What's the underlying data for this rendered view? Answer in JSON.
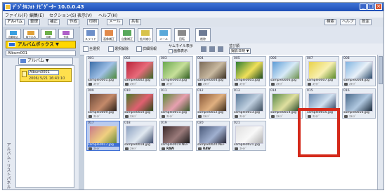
{
  "window": {
    "title": "ﾃﾞｼﾞﾀﾙﾌｫﾄ ﾅﾋﾞｹﾞｰﾀｰ 10.0.0.43",
    "controls": [
      "_",
      "□",
      "×"
    ]
  },
  "menubar": [
    "ファイル(F)",
    "編集(E)",
    "セクション(S)",
    "表示(V)",
    "ヘルプ(H)"
  ],
  "top_tabs": [
    "アルバム",
    "整理",
    "補正",
    "作成",
    "印刷",
    "メール",
    "共有"
  ],
  "right_tabs": [
    "検索",
    "ヘルプ",
    "設定"
  ],
  "left_panel": {
    "big_icons": [
      "自動取込",
      "取り込み",
      "印刷",
      "作成"
    ],
    "album_box_label": "アルバムボックス",
    "folder_select": "Album001",
    "vertical_label": "アルバム・リストパネル",
    "album_header": "アルバム",
    "album_item": {
      "name": "Album0001",
      "date": "2006/ 5/21  16:43:10"
    }
  },
  "toolbar": {
    "tools": [
      "スライド",
      "画像補正",
      "自動補正",
      "拡大縮小",
      "メール",
      "回転",
      "削除"
    ]
  },
  "options": {
    "select_all": "全選択",
    "select_clear": "選択解除",
    "info": "詳細情報",
    "thumb_label": "サムネイル表示",
    "thumb_checkbox": "画像表示",
    "sort_label": "並び順",
    "sort_value": "撮影日時"
  },
  "thumbnails": [
    {
      "num": "001",
      "file": "sample0001.jpg",
      "tag": "ｽﾗｲﾄﾞ"
    },
    {
      "num": "002",
      "file": "sample0002.jpg",
      "tag": "ｽﾗｲﾄﾞ"
    },
    {
      "num": "003",
      "file": "sample0003.jpg",
      "tag": "ｽﾗｲﾄﾞ"
    },
    {
      "num": "004",
      "file": "sample0004.jpg",
      "tag": "ｽﾗｲﾄﾞ"
    },
    {
      "num": "005",
      "file": "sample0005.jpg",
      "tag": "ｽﾗｲﾄﾞ"
    },
    {
      "num": "006",
      "file": "sample0006.jpg",
      "tag": "ｽﾗｲﾄﾞ"
    },
    {
      "num": "007",
      "file": "sample0007.jpg",
      "tag": "ｽﾗｲﾄﾞ"
    },
    {
      "num": "008",
      "file": "sample0008.jpg",
      "tag": "ｽﾗｲﾄﾞ"
    },
    {
      "num": "009",
      "file": "sample0009.jpg",
      "tag": "ｽﾗｲﾄﾞ"
    },
    {
      "num": "010",
      "file": "sample0010.jpg",
      "tag": "ｽﾗｲﾄﾞ"
    },
    {
      "num": "011",
      "file": "sample0011.jpg",
      "tag": "ｽﾗｲﾄﾞ"
    },
    {
      "num": "012",
      "file": "sample0012.jpg",
      "tag": "ｽﾗｲﾄﾞ"
    },
    {
      "num": "013",
      "file": "sample0013.jpg",
      "tag": "ｽﾗｲﾄﾞ"
    },
    {
      "num": "014",
      "file": "sample0014.jpg",
      "tag": "ｽﾗｲﾄﾞ"
    },
    {
      "num": "015",
      "file": "sample0015.jpg",
      "tag": "ｽﾗｲﾄﾞ"
    },
    {
      "num": "016",
      "file": "sample0016.jpg",
      "tag": "ｽﾗｲﾄﾞ"
    },
    {
      "num": "017",
      "file": "sample0017.jpg",
      "tag": "ｽﾗｲﾄﾞ"
    },
    {
      "num": "018",
      "file": "sample0018.jpg",
      "tag": "ｽﾗｲﾄﾞ"
    },
    {
      "num": "019",
      "file": "sample0019.NEF",
      "tag": "RAW"
    },
    {
      "num": "020",
      "file": "sample0020.NEF",
      "tag": "RAW"
    },
    {
      "num": "021",
      "file": "sample0021.jpg",
      "tag": "ｽﾗｲﾄﾞ"
    }
  ],
  "selected_index": 16,
  "colors": {
    "titlebar": "#1f4fb6",
    "album_box": "#ffd700",
    "highlight_frame": "#d4291a",
    "selection": "#3e6fd4"
  }
}
